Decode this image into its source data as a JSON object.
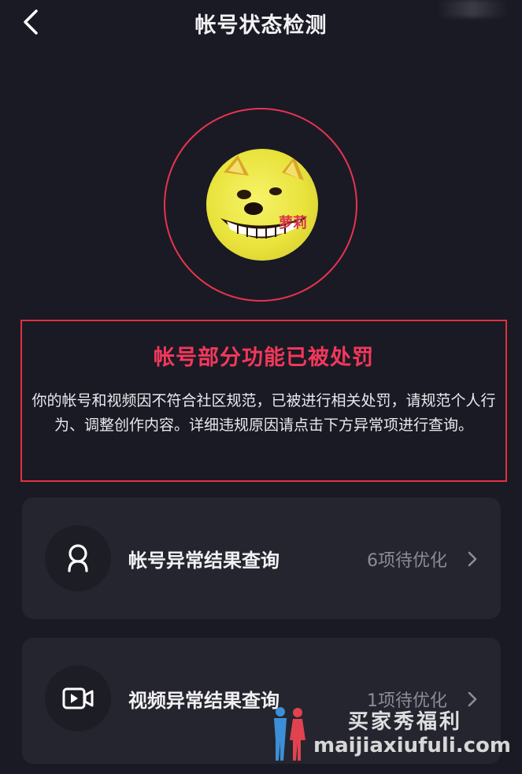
{
  "header": {
    "title": "帐号状态检测"
  },
  "avatar": {
    "overlay_text": "萝莉"
  },
  "notice": {
    "title": "帐号部分功能已被处罚",
    "body": "你的帐号和视频因不符合社区规范，已被进行相关处罚，请规范个人行为、调整创作内容。详细违规原因请点击下方异常项进行查询。"
  },
  "cards": [
    {
      "label": "帐号异常结果查询",
      "status": "6项待优化",
      "icon": "user-icon"
    },
    {
      "label": "视频异常结果查询",
      "status": "1项待优化",
      "icon": "video-icon"
    }
  ],
  "watermark": {
    "cn": "买家秀福利",
    "en": "maijiaxiufuli.com"
  },
  "colors": {
    "background": "#1a1a24",
    "card": "#25252f",
    "accent_red": "#f3385b",
    "ring": "#e8334f",
    "muted": "#8c8c98"
  }
}
